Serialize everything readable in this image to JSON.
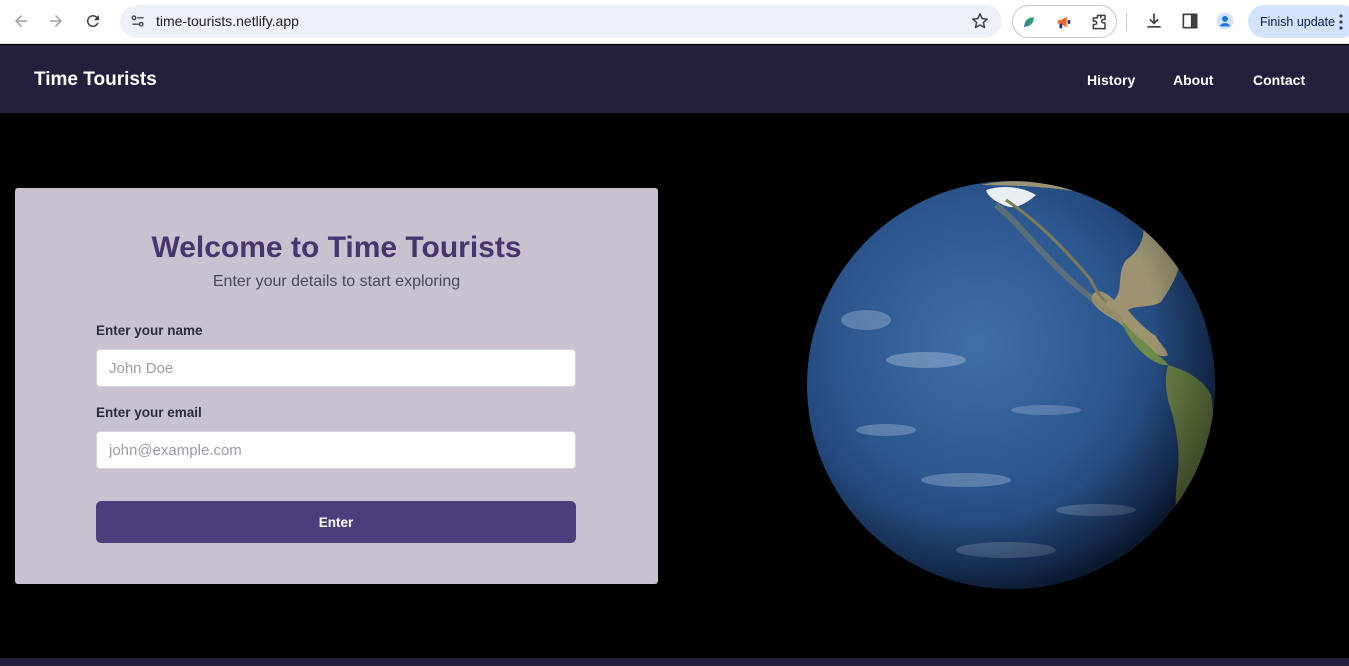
{
  "browser": {
    "url": "time-tourists.netlify.app",
    "finish_update_label": "Finish update",
    "icons": [
      "back-arrow-icon",
      "forward-arrow-icon",
      "reload-icon",
      "site-settings-icon",
      "bookmark-star-icon",
      "extension-leaf-icon",
      "extension-megaphone-icon",
      "extensions-puzzle-icon",
      "download-icon",
      "side-panel-icon",
      "profile-avatar-icon",
      "more-menu-icon"
    ]
  },
  "header": {
    "brand": "Time Tourists",
    "nav": [
      {
        "label": "History"
      },
      {
        "label": "About"
      },
      {
        "label": "Contact"
      }
    ],
    "background": "#22203a"
  },
  "form": {
    "title": "Welcome to Time Tourists",
    "subtitle": "Enter your details to start exploring",
    "name_label": "Enter your name",
    "name_placeholder": "John Doe",
    "email_label": "Enter your email",
    "email_placeholder": "john@example.com",
    "submit_label": "Enter",
    "accent": "#4e3d7d",
    "card_color": "#c8c2d0"
  },
  "visual": {
    "globe": "earth-globe"
  }
}
